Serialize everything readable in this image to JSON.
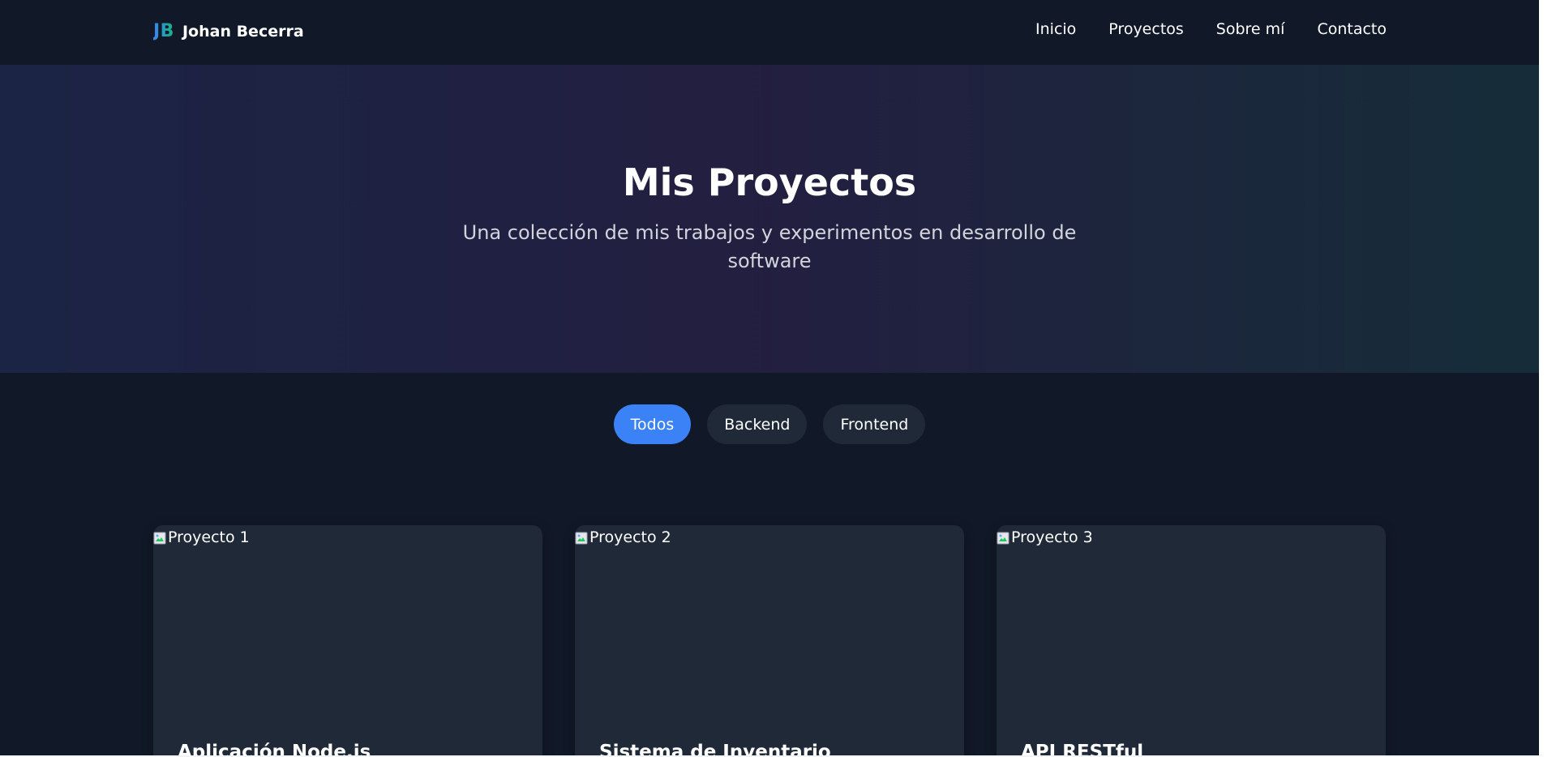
{
  "navbar": {
    "logo": "JB",
    "name": "Johan Becerra",
    "links": [
      "Inicio",
      "Proyectos",
      "Sobre mí",
      "Contacto"
    ]
  },
  "hero": {
    "title": "Mis Proyectos",
    "subtitle": "Una colección de mis trabajos y experimentos en desarrollo de software"
  },
  "filters": {
    "items": [
      "Todos",
      "Backend",
      "Frontend"
    ],
    "active": "Todos"
  },
  "projects": [
    {
      "image_alt": "Proyecto 1",
      "title": "Aplicación Node.js"
    },
    {
      "image_alt": "Proyecto 2",
      "title": "Sistema de Inventario"
    },
    {
      "image_alt": "Proyecto 3",
      "title": "API RESTful"
    }
  ],
  "colors": {
    "background": "#111827",
    "card": "#1f2937",
    "accent": "#3b82f6",
    "accent_secondary": "#10b981"
  }
}
